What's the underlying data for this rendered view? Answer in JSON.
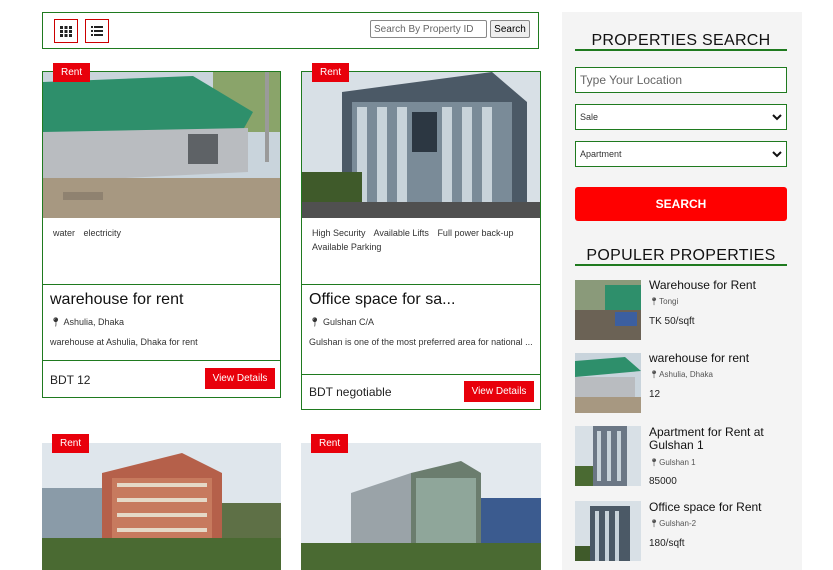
{
  "toolbar": {
    "grid_view_icon": "grid-icon",
    "list_view_icon": "list-icon",
    "search_placeholder": "Search By Property ID",
    "search_label": "Search"
  },
  "listings": [
    {
      "badge": "Rent",
      "features": [
        "water",
        "electricity"
      ],
      "title": "warehouse for rent",
      "location": "Ashulia, Dhaka",
      "description": "warehouse at Ashulia, Dhaka for rent",
      "price": "BDT 12",
      "button": "View Details"
    },
    {
      "badge": "Rent",
      "features": [
        "High Security",
        "Available Lifts",
        "Full power back-up",
        "Available Parking"
      ],
      "title": "Office space for sa...",
      "location": "Gulshan C/A",
      "description": "Gulshan is one of the most preferred area for national ...",
      "price": "BDT negotiable",
      "button": "View Details"
    },
    {
      "badge": "Rent"
    },
    {
      "badge": "Rent"
    }
  ],
  "sidebar": {
    "search_heading": "PROPERTIES SEARCH",
    "location_placeholder": "Type Your Location",
    "purpose_value": "Sale",
    "type_value": "Apartment",
    "search_button": "SEARCH",
    "popular_heading": "POPULER PROPERTIES",
    "popular": [
      {
        "title": "Warehouse for Rent",
        "location": "Tongi",
        "price": "TK 50/sqft"
      },
      {
        "title": "warehouse for rent",
        "location": "Ashulia, Dhaka",
        "price": "12"
      },
      {
        "title": "Apartment for Rent at Gulshan 1",
        "location": "Gulshan 1",
        "price": "85000"
      },
      {
        "title": "Office space for Rent",
        "location": "Gulshan-2",
        "price": "180/sqft"
      }
    ]
  },
  "colors": {
    "accent_red": "#e8000b",
    "border_green": "#1f7a1f",
    "sidebar_bg": "#f4f4f4"
  }
}
